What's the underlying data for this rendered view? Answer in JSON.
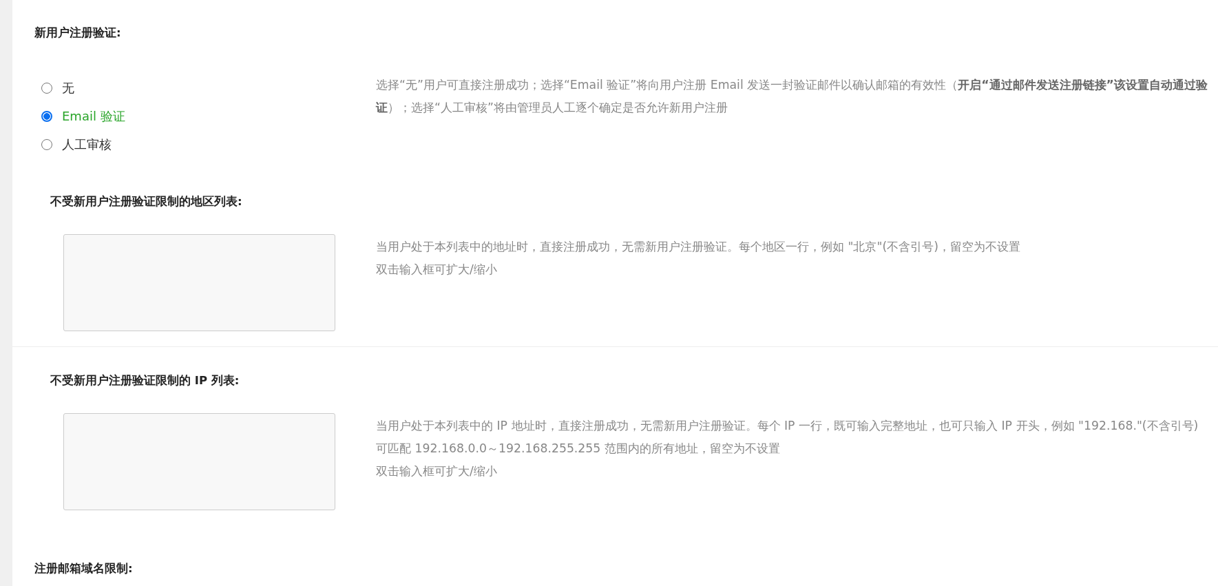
{
  "sections": [
    {
      "kind": "radio",
      "title": "新用户注册验证:",
      "options": [
        {
          "label": "无",
          "selected": false
        },
        {
          "label": "Email 验证",
          "selected": true
        },
        {
          "label": "人工审核",
          "selected": false
        }
      ],
      "description": [
        "选择“无”用户可直接注册成功；选择“Email 验证”将向用户注册 Email 发送一封验证邮件以确认邮箱的有效性（**开启“通过邮件发送注册链接”该设置自动通过验证**）；选择“人工审核”将由管理员人工逐个确定是否允许新用户注册"
      ]
    },
    {
      "kind": "textarea",
      "title": "不受新用户注册验证限制的地区列表:",
      "description": [
        "当用户处于本列表中的地址时，直接注册成功，无需新用户注册验证。每个地区一行，例如 \"北京\"(不含引号)，留空为不设置",
        "双击输入框可扩大/缩小"
      ]
    },
    {
      "kind": "textarea",
      "title": "不受新用户注册验证限制的 IP 列表:",
      "description": [
        "当用户处于本列表中的 IP 地址时，直接注册成功，无需新用户注册验证。每个 IP 一行，既可输入完整地址，也可只输入 IP 开头，例如 \"192.168.\"(不含引号) 可匹配 192.168.0.0～192.168.255.255 范围内的所有地址，留空为不设置",
        "双击输入框可扩大/缩小"
      ]
    },
    {
      "kind": "heading",
      "title": "注册邮箱域名限制:"
    }
  ]
}
